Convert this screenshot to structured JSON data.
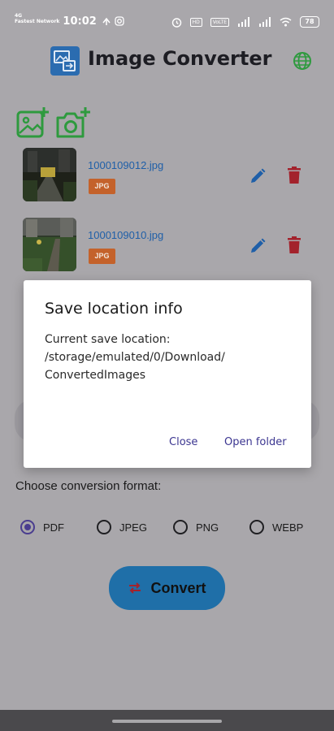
{
  "status_bar": {
    "carrier_line1": "4G",
    "carrier_line2": "Fastest Network",
    "time": "10:02",
    "tag1": "HD",
    "tag2": "VoLTE",
    "battery": "78"
  },
  "header": {
    "title": "Image Converter"
  },
  "files": [
    {
      "name": "1000109012.jpg",
      "badge": "JPG"
    },
    {
      "name": "1000109010.jpg",
      "badge": "JPG"
    }
  ],
  "format_section": {
    "label": "Choose conversion format:",
    "options": [
      {
        "label": "PDF",
        "selected": true
      },
      {
        "label": "JPEG",
        "selected": false
      },
      {
        "label": "PNG",
        "selected": false
      },
      {
        "label": "WEBP",
        "selected": false
      }
    ]
  },
  "convert_button": {
    "label": "Convert"
  },
  "dialog": {
    "title": "Save location info",
    "line1": "Current save location:",
    "line2": "/storage/emulated/0/Download/",
    "line3": "ConvertedImages",
    "close_label": "Close",
    "open_label": "Open folder"
  },
  "colors": {
    "accent": "#4a3d8f",
    "link": "#1f5fa8",
    "badge": "#c4622b",
    "delete": "#a3222c",
    "convert": "#1f6fa8",
    "icon_green": "#2e9a3e"
  }
}
